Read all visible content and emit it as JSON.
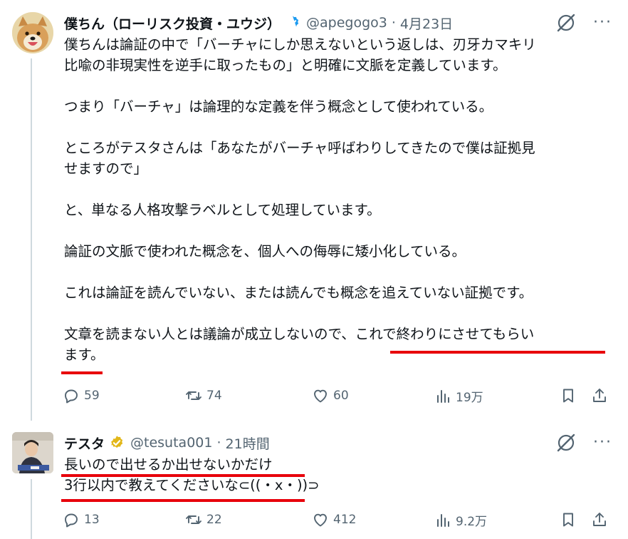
{
  "tweet1": {
    "name": "僕ちん（ローリスク投資・ユウジ）",
    "handle": "@apegogo3",
    "separator": "·",
    "time": "4月23日",
    "more": "···",
    "lines": [
      "僕ちんは論証の中で「バーチャにしか思えないという返しは、刃牙カマキリ",
      "比喩の非現実性を逆手に取ったもの」と明確に文脈を定義しています。",
      "",
      "つまり「バーチャ」は論理的な定義を伴う概念として使われている。",
      "",
      "ところがテスタさんは「あなたがバーチャ呼ばわりしてきたので僕は証拠見",
      "せますので」",
      "",
      "と、単なる人格攻撃ラベルとして処理しています。",
      "",
      "論証の文脈で使われた概念を、個人への侮辱に矮小化している。",
      "",
      "これは論証を読んでいない、または読んでも概念を追えていない証拠です。",
      "",
      "文章を読まない人とは議論が成立しないので、これで終わりにさせてもらい",
      "ます。"
    ],
    "replies": "59",
    "retweets": "74",
    "likes": "60",
    "views": "19万",
    "colors": {
      "verified": "#1d9bf0",
      "underline": "#e8000b"
    }
  },
  "tweet2": {
    "name": "テスタ",
    "handle": "@tesuta001",
    "separator": "·",
    "time": "21時間",
    "more": "···",
    "lines": [
      "長いので出せるか出せないかだけ",
      "3行以内で教えてくださいな⊂((・x・))⊃"
    ],
    "replies": "13",
    "retweets": "22",
    "likes": "412",
    "views": "9.2万",
    "colors": {
      "verified": "#e2b719"
    }
  },
  "icons": [
    "verified-badge-icon",
    "grok-icon",
    "more-icon",
    "reply-icon",
    "retweet-icon",
    "like-icon",
    "views-icon",
    "bookmark-icon",
    "share-icon"
  ]
}
